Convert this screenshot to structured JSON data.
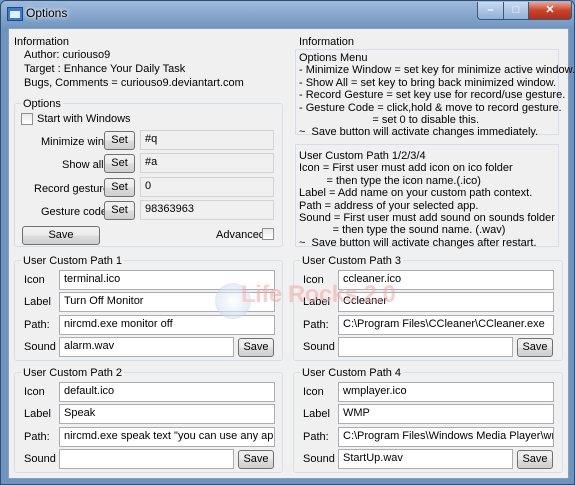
{
  "window": {
    "title": "Options",
    "min_glyph": "–",
    "max_glyph": "□",
    "close_glyph": "✕"
  },
  "info_left": {
    "title": "Information",
    "author": "Author: curiouso9",
    "target": "Target : Enhance Your Daily Task",
    "bugs": "Bugs, Comments = curiouso9.deviantart.com"
  },
  "options": {
    "title": "Options",
    "start_with_windows": "Start with Windows",
    "minimize_label": "Minimize window:",
    "minimize_value": "#q",
    "showall_label": "Show all:",
    "showall_value": "#a",
    "record_label": "Record gesture:",
    "record_value": "0",
    "gesture_label": "Gesture code:",
    "gesture_value": "98363963",
    "set_label": "Set",
    "save_label": "Save",
    "advanced_label": "Advanced"
  },
  "info_right": {
    "title": "Information",
    "menu_lines": [
      "Options Menu",
      "- Minimize Window = set key for minimize active window.",
      "- Show All = set key to bring back minimized window.",
      "- Record Gesture = set key use for record/use gesture.",
      "- Gesture Code = click,hold & move to record gesture.",
      "                        = set 0 to disable this.",
      "~  Save button will activate changes immediately."
    ],
    "custom_lines": [
      "User Custom Path 1/2/3/4",
      "Icon = First user must add icon on ico folder",
      "         = then type the icon name.(.ico)",
      "Label = Add name on your custom path context.",
      "Path = address of your selected app.",
      "Sound = First user must add sound on sounds folder",
      "           = then type the sound name. (.wav)",
      "~  Save button will activate changes after restart."
    ]
  },
  "field_labels": {
    "icon": "Icon",
    "label": "Label",
    "path": "Path:",
    "sound": "Sound",
    "save": "Save"
  },
  "paths": [
    {
      "title": "User Custom Path 1",
      "icon": "terminal.ico",
      "label": "Turn Off Monitor",
      "path": "nircmd.exe monitor off",
      "sound": "alarm.wav"
    },
    {
      "title": "User Custom Path 2",
      "icon": "default.ico",
      "label": "Speak",
      "path": "nircmd.exe speak text \"you can use any application",
      "sound": ""
    },
    {
      "title": "User Custom Path 3",
      "icon": "ccleaner.ico",
      "label": "Ccleaner",
      "path": "C:\\Program Files\\CCleaner\\CCleaner.exe",
      "sound": ""
    },
    {
      "title": "User Custom Path 4",
      "icon": "wmplayer.ico",
      "label": "WMP",
      "path": "C:\\Program Files\\Windows Media Player\\wmplayer",
      "sound": "StartUp.wav"
    }
  ],
  "watermark": {
    "text": "Life Rocks 2.0"
  }
}
